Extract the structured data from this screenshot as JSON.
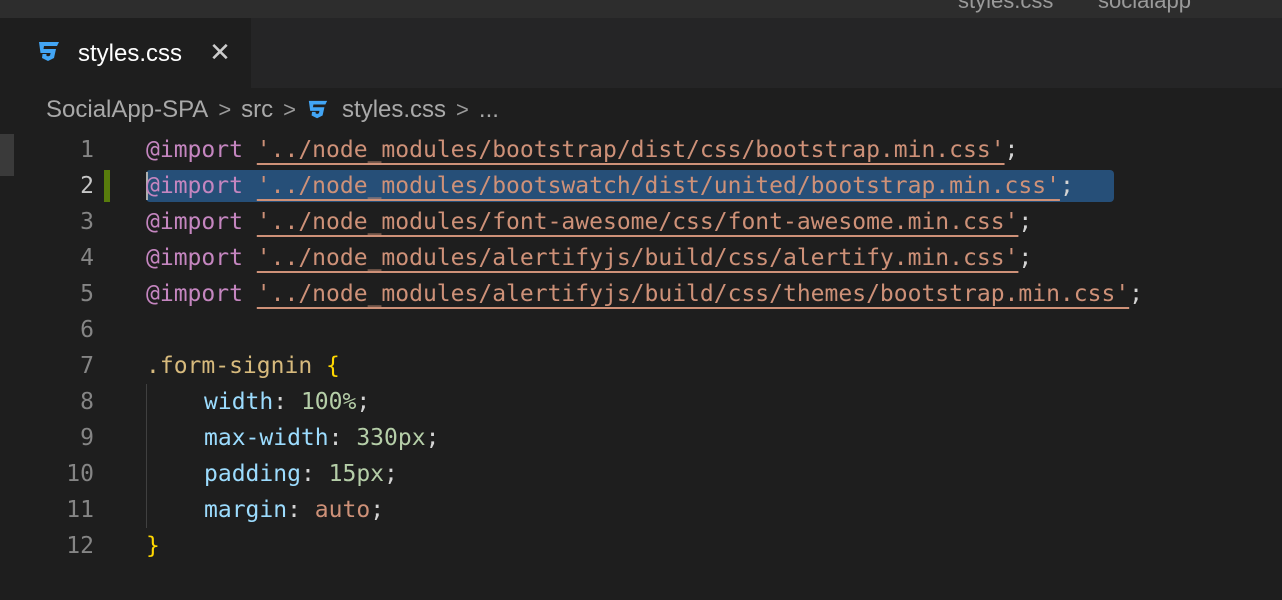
{
  "titlebar": {
    "left_text": "styles.css",
    "right_text": "socialapp"
  },
  "tab": {
    "label": "styles.css",
    "close_glyph": "✕",
    "icon": "css3-icon"
  },
  "breadcrumb": {
    "items": [
      "SocialApp-SPA",
      "src",
      "styles.css",
      "..."
    ],
    "separator": ">"
  },
  "editor": {
    "active_line": 2,
    "line_numbers": [
      "1",
      "2",
      "3",
      "4",
      "5",
      "6",
      "7",
      "8",
      "9",
      "10",
      "11",
      "12"
    ],
    "lines": [
      {
        "kw": "@import",
        "str": "'../node_modules/bootstrap/dist/css/bootstrap.min.css'",
        "end": ";"
      },
      {
        "kw": "@import",
        "str": "'../node_modules/bootswatch/dist/united/bootstrap.min.css'",
        "end": ";"
      },
      {
        "kw": "@import",
        "str": "'../node_modules/font-awesome/css/font-awesome.min.css'",
        "end": ";"
      },
      {
        "kw": "@import",
        "str": "'../node_modules/alertifyjs/build/css/alertify.min.css'",
        "end": ";"
      },
      {
        "kw": "@import",
        "str": "'../node_modules/alertifyjs/build/css/themes/bootstrap.min.css'",
        "end": ";"
      }
    ],
    "rule": {
      "selector": ".form-signin",
      "open": "{",
      "close": "}",
      "declarations": [
        {
          "prop": "width",
          "value": "100%"
        },
        {
          "prop": "max-width",
          "value": "330px"
        },
        {
          "prop": "padding",
          "value": "15px"
        },
        {
          "prop": "margin",
          "value": "auto"
        }
      ]
    }
  },
  "colors": {
    "background": "#1e1e1e",
    "keyword": "#c586c0",
    "string": "#ce9178",
    "property": "#9cdcfe",
    "number": "#b5cea8",
    "selection": "#264f78",
    "brace": "#ffd700",
    "css_icon": "#42a5f5"
  }
}
